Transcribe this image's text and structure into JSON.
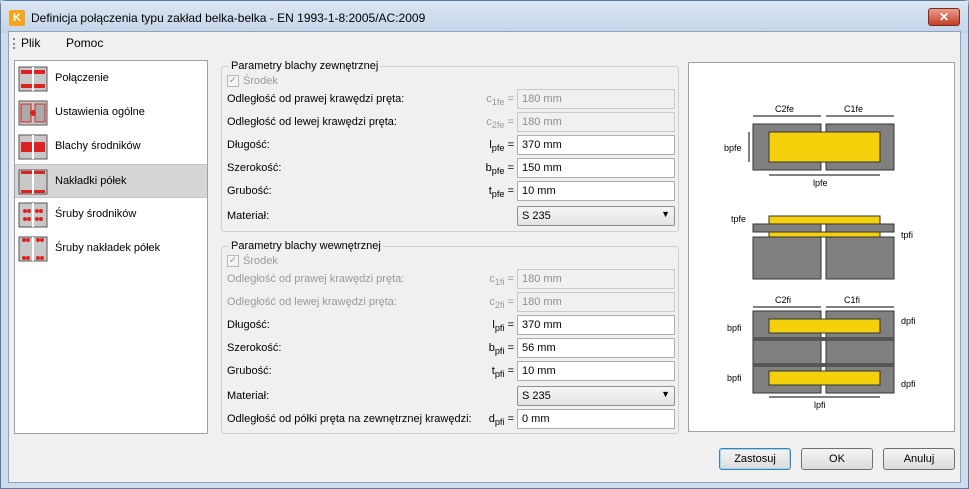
{
  "window": {
    "title": "Definicja połączenia typu zakład belka-belka - EN 1993-1-8:2005/AC:2009",
    "close": "✕",
    "icon": "K"
  },
  "menu": [
    "Plik",
    "Pomoc"
  ],
  "nav": [
    {
      "label": "Połączenie",
      "icon": "connection-icon"
    },
    {
      "label": "Ustawienia ogólne",
      "icon": "general-settings-icon"
    },
    {
      "label": "Blachy środników",
      "icon": "web-plates-icon"
    },
    {
      "label": "Nakładki półek",
      "icon": "flange-cover-plates-icon",
      "active": true
    },
    {
      "label": "Śruby środników",
      "icon": "web-bolts-icon"
    },
    {
      "label": "Śruby nakładek półek",
      "icon": "flange-bolts-icon"
    }
  ],
  "outer": {
    "title": "Parametry blachy zewnętrznej",
    "center_label": "Środek",
    "rows": [
      {
        "label": "Odległość od prawej krawędzi pręta:",
        "sym": "c",
        "sub": "1fe",
        "eq": " =",
        "value": "180 mm",
        "disabled": true
      },
      {
        "label": "Odległość od lewej krawędzi pręta:",
        "sym": "c",
        "sub": "2fe",
        "eq": " =",
        "value": "180 mm",
        "disabled": true
      },
      {
        "label": "Długość:",
        "sym": "l",
        "sub": "pfe",
        "eq": " =",
        "value": "370 mm"
      },
      {
        "label": "Szerokość:",
        "sym": "b",
        "sub": "pfe",
        "eq": " =",
        "value": "150 mm"
      },
      {
        "label": "Grubość:",
        "sym": "t",
        "sub": "pfe",
        "eq": " =",
        "value": "10 mm"
      }
    ],
    "material_label": "Materiał:",
    "material": "S 235"
  },
  "inner": {
    "title": "Parametry blachy wewnętrznej",
    "center_label": "Środek",
    "rows": [
      {
        "label": "Odległość od prawej krawędzi pręta:",
        "sym": "c",
        "sub": "1fi",
        "eq": " =",
        "value": "180 mm",
        "disabled": true
      },
      {
        "label": "Odległość od lewej krawędzi pręta:",
        "sym": "c",
        "sub": "2fi",
        "eq": " =",
        "value": "180 mm",
        "disabled": true
      },
      {
        "label": "Długość:",
        "sym": "l",
        "sub": "pfi",
        "eq": " =",
        "value": "370 mm"
      },
      {
        "label": "Szerokość:",
        "sym": "b",
        "sub": "pfi",
        "eq": " =",
        "value": "56 mm"
      },
      {
        "label": "Grubość:",
        "sym": "t",
        "sub": "pfi",
        "eq": " =",
        "value": "10 mm"
      }
    ],
    "material_label": "Materiał:",
    "material": "S 235",
    "edge_label": "Odległość od półki pręta na zewnętrznej krawędzi:",
    "edge_sym": "d",
    "edge_sub": "pfi",
    "edge_eq": " =",
    "edge_value": "0 mm"
  },
  "diagram": {
    "top": {
      "c2": "C2fe",
      "c1": "C1fe",
      "b": "bpfe",
      "l": "lpfe"
    },
    "mid": {
      "t_outer": "tpfe",
      "t_inner": "tpfi"
    },
    "bottom": {
      "c2": "C2fi",
      "c1": "C1fi",
      "b": "bpfi",
      "d": "dpfi",
      "l": "lpfi"
    }
  },
  "buttons": {
    "apply": "Zastosuj",
    "ok": "OK",
    "cancel": "Anuluj"
  },
  "colors": {
    "plate": "#f5d10c",
    "beam": "#808080",
    "active_nav": "#d6d6d6"
  }
}
